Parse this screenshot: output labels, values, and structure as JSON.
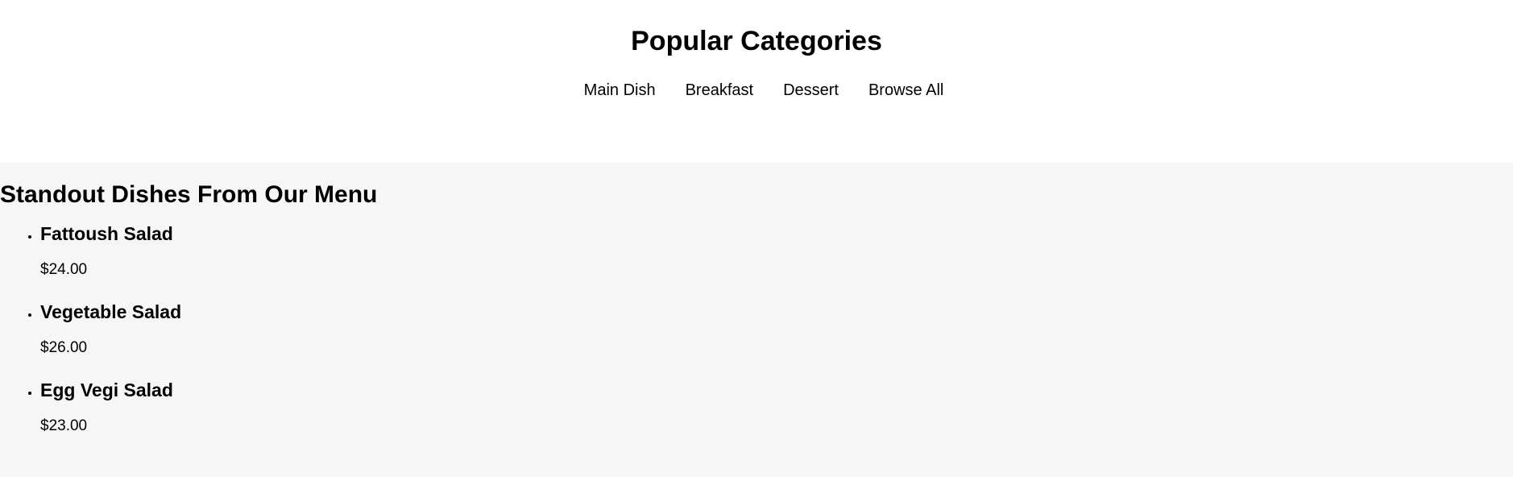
{
  "categories": {
    "title": "Popular Categories",
    "links": [
      {
        "label": "Main Dish"
      },
      {
        "label": "Breakfast"
      },
      {
        "label": "Dessert"
      },
      {
        "label": "Browse All"
      }
    ]
  },
  "menu": {
    "title": "Standout Dishes From Our Menu",
    "dishes": [
      {
        "name": "Fattoush Salad",
        "price": "$24.00"
      },
      {
        "name": "Vegetable Salad",
        "price": "$26.00"
      },
      {
        "name": "Egg Vegi Salad",
        "price": "$23.00"
      }
    ]
  }
}
